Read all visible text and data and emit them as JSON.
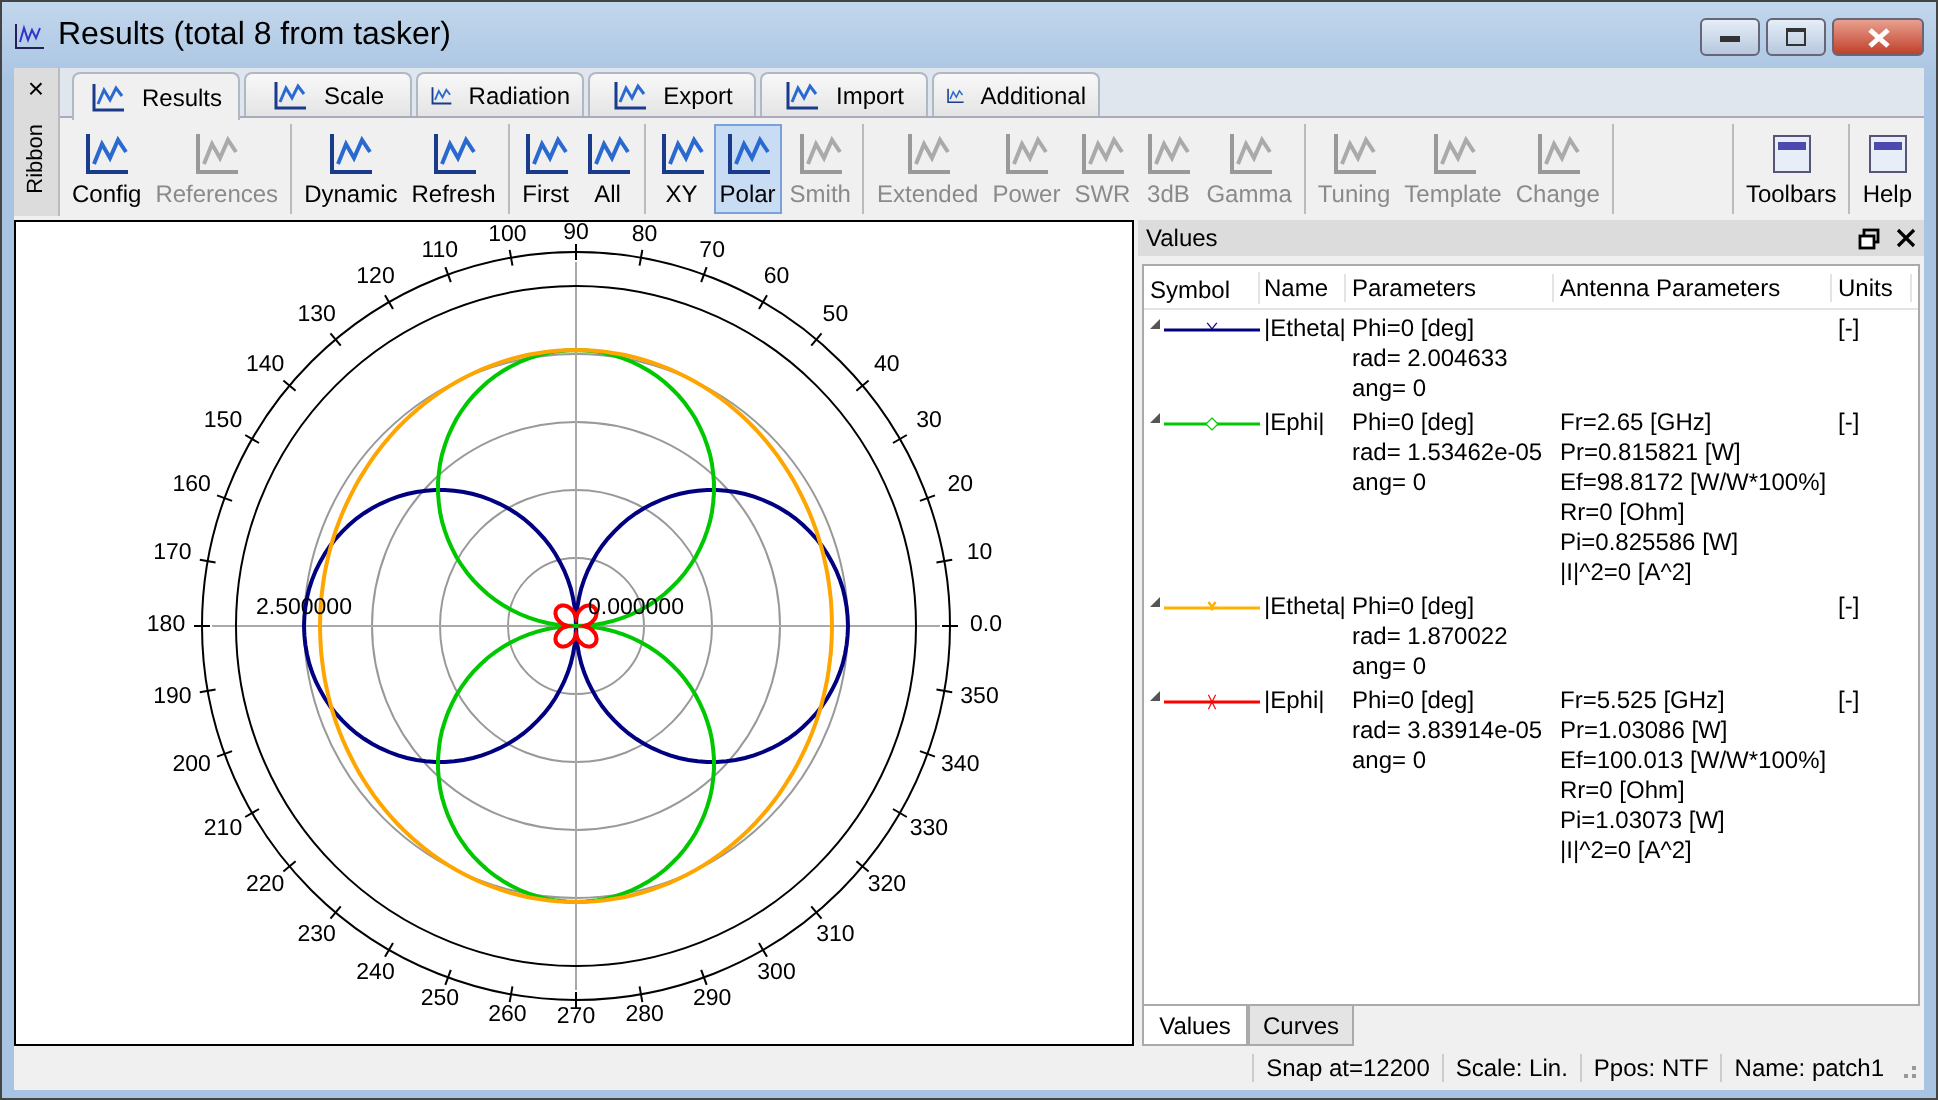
{
  "window": {
    "title": "Results (total 8 from tasker)"
  },
  "ribbon": {
    "side_label": "Ribbon",
    "close": "×",
    "tabs": [
      {
        "label": "Results",
        "selected": true
      },
      {
        "label": "Scale",
        "selected": false
      },
      {
        "label": "Radiation",
        "selected": false
      },
      {
        "label": "Export",
        "selected": false
      },
      {
        "label": "Import",
        "selected": false
      },
      {
        "label": "Additional",
        "selected": false
      }
    ],
    "groups": [
      [
        {
          "label": "Config",
          "disabled": false,
          "selected": false
        },
        {
          "label": "References",
          "disabled": true,
          "selected": false
        }
      ],
      [
        {
          "label": "Dynamic",
          "disabled": false,
          "selected": false
        },
        {
          "label": "Refresh",
          "disabled": false,
          "selected": false
        }
      ],
      [
        {
          "label": "First",
          "disabled": false,
          "selected": false
        },
        {
          "label": "All",
          "disabled": false,
          "selected": false
        }
      ],
      [
        {
          "label": "XY",
          "disabled": false,
          "selected": false
        },
        {
          "label": "Polar",
          "disabled": false,
          "selected": true
        },
        {
          "label": "Smith",
          "disabled": true,
          "selected": false
        }
      ],
      [
        {
          "label": "Extended",
          "disabled": true,
          "selected": false
        },
        {
          "label": "Power",
          "disabled": true,
          "selected": false
        },
        {
          "label": "SWR",
          "disabled": true,
          "selected": false
        },
        {
          "label": "3dB",
          "disabled": true,
          "selected": false
        },
        {
          "label": "Gamma",
          "disabled": true,
          "selected": false
        }
      ],
      [
        {
          "label": "Tuning",
          "disabled": true,
          "selected": false
        },
        {
          "label": "Template",
          "disabled": true,
          "selected": false
        },
        {
          "label": "Change",
          "disabled": true,
          "selected": false
        }
      ]
    ],
    "right_groups": [
      [
        {
          "label": "Toolbars",
          "disabled": false,
          "selected": false
        }
      ],
      [
        {
          "label": "Help",
          "disabled": false,
          "selected": false
        }
      ]
    ]
  },
  "plot": {
    "angle_labels": [
      "100",
      "90",
      "80",
      "110",
      "70",
      "120",
      "60",
      "130",
      "50",
      "140",
      "40",
      "150",
      "30",
      "160",
      "20",
      "170",
      "10",
      "180",
      "0.0",
      "190",
      "350",
      "200",
      "340",
      "210",
      "330",
      "220",
      "320",
      "230",
      "310",
      "240",
      "300",
      "250",
      "290",
      "260",
      "270",
      "280"
    ],
    "outer_radius_label": "2.500000",
    "center_label": "0.000000",
    "curves": [
      {
        "kind": "horizontal-lobes",
        "color": "#000080"
      },
      {
        "kind": "vertical-lobes",
        "color": "#00c800"
      },
      {
        "kind": "ellipse",
        "color": "#ffa500"
      },
      {
        "kind": "four-lobes",
        "color": "#ff0000"
      }
    ]
  },
  "values_panel": {
    "title": "Values",
    "columns": [
      "Symbol",
      "Name",
      "Parameters",
      "Antenna Parameters",
      "Units"
    ],
    "rows": [
      {
        "color": "#000080",
        "kind": "v",
        "name": "|Etheta|",
        "parameters": [
          "Phi=0 [deg]",
          "rad= 2.004633",
          "ang= 0"
        ],
        "antenna": [],
        "units": "[-]"
      },
      {
        "color": "#00c800",
        "kind": "diamond",
        "name": "|Ephi|",
        "parameters": [
          "Phi=0 [deg]",
          "rad= 1.53462e-05",
          "ang= 0"
        ],
        "antenna": [
          "Fr=2.65 [GHz]",
          "Pr=0.815821 [W]",
          "Ef=98.8172 [W/W*100%]",
          "Rr=0 [Ohm]",
          "Pi=0.825586 [W]",
          " |I|^2=0 [A^2]"
        ],
        "units": "[-]"
      },
      {
        "color": "#ffb000",
        "kind": "y",
        "name": "|Etheta|",
        "parameters": [
          "Phi=0 [deg]",
          "rad= 1.870022",
          "ang= 0"
        ],
        "antenna": [],
        "units": "[-]"
      },
      {
        "color": "#ff0000",
        "kind": "x",
        "name": "|Ephi|",
        "parameters": [
          "Phi=0 [deg]",
          "rad= 3.83914e-05",
          "ang= 0"
        ],
        "antenna": [
          "Fr=5.525 [GHz]",
          "Pr=1.03086 [W]",
          "Ef=100.013 [W/W*100%]",
          "Rr=0 [Ohm]",
          "Pi=1.03073 [W]",
          " |I|^2=0 [A^2]"
        ],
        "units": "[-]"
      }
    ],
    "tabs": [
      {
        "label": "Values",
        "selected": true
      },
      {
        "label": "Curves",
        "selected": false
      }
    ]
  },
  "status_bar": [
    "Snap at=12200",
    "Scale: Lin.",
    "Ppos: NTF",
    "Name: patch1"
  ]
}
